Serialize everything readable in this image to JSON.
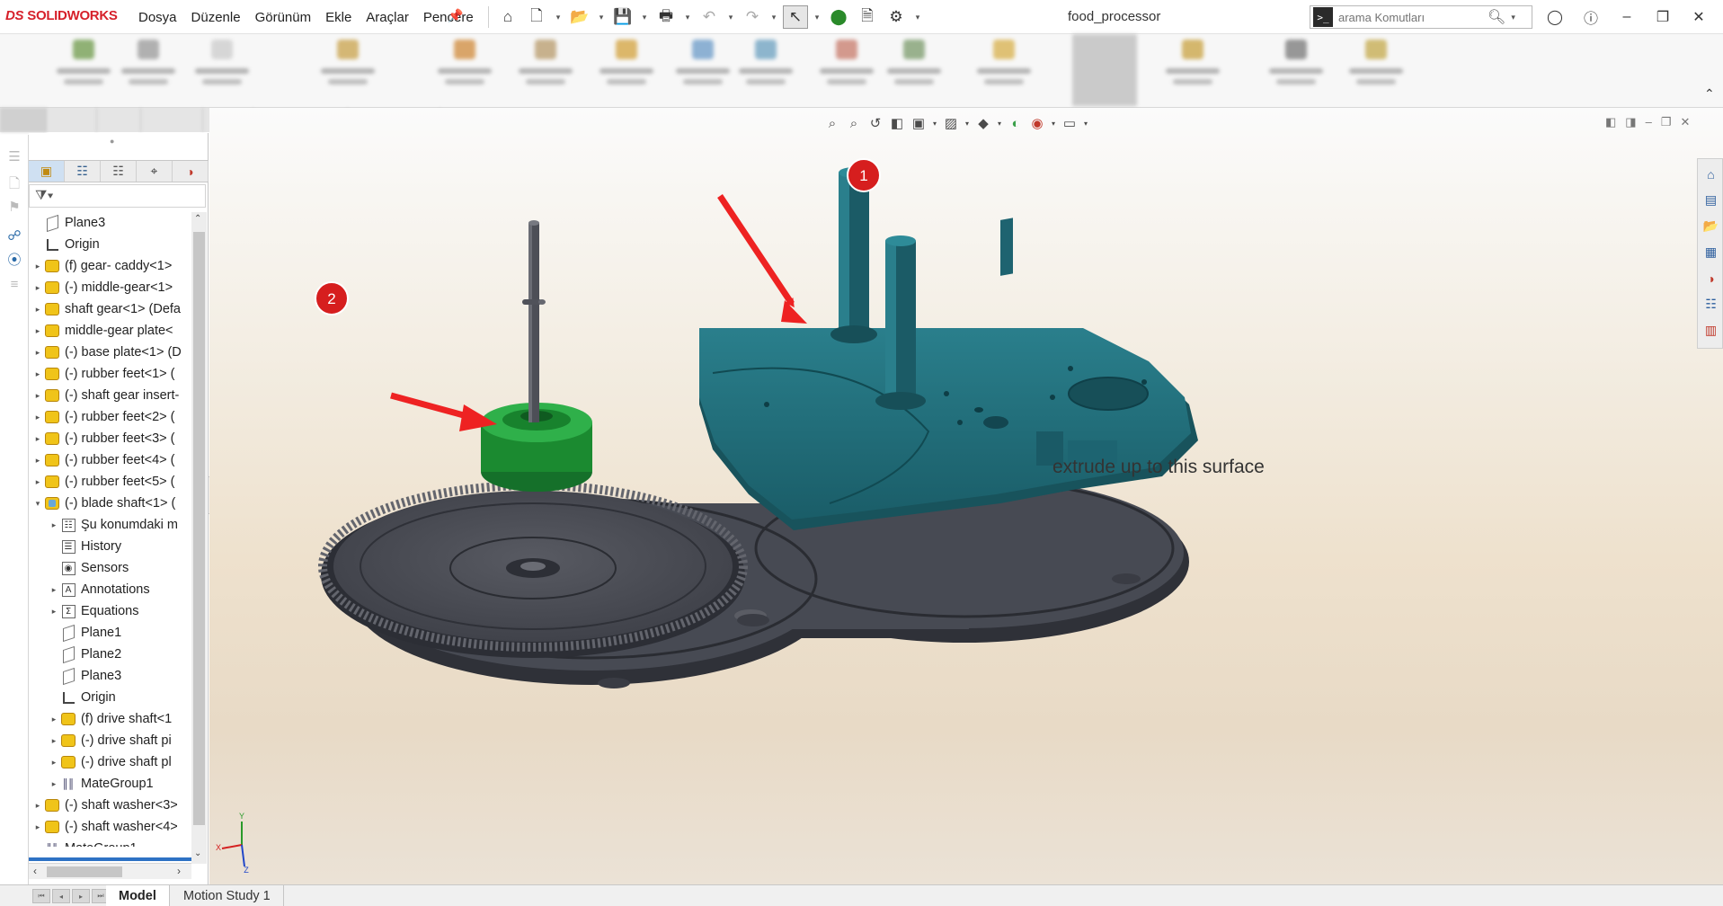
{
  "app": {
    "logo": "SOLIDWORKS",
    "document_title": "food_processor"
  },
  "menus": [
    "Dosya",
    "Düzenle",
    "Görünüm",
    "Ekle",
    "Araçlar",
    "Pencere"
  ],
  "search": {
    "placeholder": "arama Komutları"
  },
  "feature_tree": {
    "rows": [
      {
        "label": "Plane3",
        "icon": "plane-icon",
        "depth": 0,
        "expander": "none"
      },
      {
        "label": "Origin",
        "icon": "origin-icon",
        "depth": 0,
        "expander": "none"
      },
      {
        "label": "(f) gear- caddy<1>",
        "icon": "part-icon",
        "depth": 0,
        "expander": "collapsed"
      },
      {
        "label": "(-) middle-gear<1>",
        "icon": "part-icon",
        "depth": 0,
        "expander": "collapsed"
      },
      {
        "label": "shaft gear<1> (Defa",
        "icon": "part-icon",
        "depth": 0,
        "expander": "collapsed"
      },
      {
        "label": "middle-gear plate<",
        "icon": "part-icon",
        "depth": 0,
        "expander": "collapsed"
      },
      {
        "label": "(-) base plate<1> (D",
        "icon": "part-icon",
        "depth": 0,
        "expander": "collapsed"
      },
      {
        "label": "(-) rubber feet<1> (",
        "icon": "part-icon",
        "depth": 0,
        "expander": "collapsed"
      },
      {
        "label": "(-) shaft gear insert-",
        "icon": "part-icon",
        "depth": 0,
        "expander": "collapsed"
      },
      {
        "label": "(-) rubber feet<2> (",
        "icon": "part-icon",
        "depth": 0,
        "expander": "collapsed"
      },
      {
        "label": "(-) rubber feet<3> (",
        "icon": "part-icon",
        "depth": 0,
        "expander": "collapsed"
      },
      {
        "label": "(-) rubber feet<4> (",
        "icon": "part-icon",
        "depth": 0,
        "expander": "collapsed"
      },
      {
        "label": "(-) rubber feet<5> (",
        "icon": "part-icon",
        "depth": 0,
        "expander": "collapsed"
      },
      {
        "label": "(-) blade shaft<1> (",
        "icon": "subassembly-icon",
        "depth": 0,
        "expander": "expanded"
      },
      {
        "label": "Şu konumdaki m",
        "icon": "notes-icon",
        "depth": 1,
        "expander": "collapsed"
      },
      {
        "label": "History",
        "icon": "history-icon",
        "depth": 1,
        "expander": "none"
      },
      {
        "label": "Sensors",
        "icon": "sensors-icon",
        "depth": 1,
        "expander": "none"
      },
      {
        "label": "Annotations",
        "icon": "annotations-icon",
        "depth": 1,
        "expander": "collapsed"
      },
      {
        "label": "Equations",
        "icon": "equations-icon",
        "depth": 1,
        "expander": "collapsed"
      },
      {
        "label": "Plane1",
        "icon": "plane-icon",
        "depth": 1,
        "expander": "none"
      },
      {
        "label": "Plane2",
        "icon": "plane-icon",
        "depth": 1,
        "expander": "none"
      },
      {
        "label": "Plane3",
        "icon": "plane-icon",
        "depth": 1,
        "expander": "none"
      },
      {
        "label": "Origin",
        "icon": "origin-icon",
        "depth": 1,
        "expander": "none"
      },
      {
        "label": "(f) drive shaft<1",
        "icon": "part-icon",
        "depth": 1,
        "expander": "collapsed"
      },
      {
        "label": "(-) drive shaft pi",
        "icon": "part-icon",
        "depth": 1,
        "expander": "collapsed"
      },
      {
        "label": "(-) drive shaft pl",
        "icon": "part-icon",
        "depth": 1,
        "expander": "collapsed"
      },
      {
        "label": "MateGroup1",
        "icon": "mates-icon",
        "depth": 1,
        "expander": "collapsed"
      },
      {
        "label": "(-) shaft washer<3>",
        "icon": "part-icon",
        "depth": 0,
        "expander": "collapsed"
      },
      {
        "label": "(-) shaft washer<4>",
        "icon": "part-icon",
        "depth": 0,
        "expander": "collapsed"
      },
      {
        "label": "MateGroup1",
        "icon": "mates-icon",
        "depth": 0,
        "expander": "collapsed"
      }
    ]
  },
  "viewport": {
    "annotation_text": "extrude up to this surface",
    "markers": [
      {
        "label": "1"
      },
      {
        "label": "2"
      }
    ],
    "triad": {
      "x_label": "X",
      "y_label": "Y",
      "z_label": "Z"
    }
  },
  "bottom_tabs": [
    {
      "label": "Model",
      "active": true
    },
    {
      "label": "Motion Study 1",
      "active": false
    }
  ],
  "colors": {
    "brand_red": "#d6202a",
    "part_teal": "#1f6b78",
    "gear_dark": "#4a4c55",
    "highlight_green": "#1f8a2c",
    "arrow_red": "#ee2222"
  }
}
